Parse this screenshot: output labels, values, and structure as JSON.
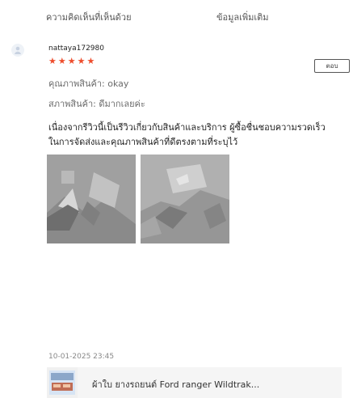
{
  "tabs": {
    "left": "ความคิดเห็นที่เห็นด้วย",
    "right": "ข้อมูลเพิ่มเติม"
  },
  "review": {
    "username": "nattaya172980",
    "rating": 5,
    "reply_label": "ตอบ",
    "quality_label": "คุณภาพสินค้า: okay",
    "condition_label": "สภาพสินค้า: ดีมากเลยค่ะ",
    "comment": "เนื่องจากรีวิวนี้เป็นรีวิวเกี่ยวกับสินค้าและบริการ ผู้ซื้อชื่นชอบความรวดเร็วในการจัดส่งและคุณภาพสินค้าที่ดีตรงตามที่ระบุไว้",
    "timestamp": "10-01-2025 23:45",
    "product_name": "ผ้าใบ ยางรถยนต์ Ford ranger Wildtrak..."
  },
  "colors": {
    "star": "#ee4d2d",
    "button_border": "#555555"
  },
  "icons": {
    "avatar": "user-avatar-icon",
    "star": "star-icon",
    "reply": "reply-icon",
    "photo": "image-icon",
    "product": "product-thumbnail-icon"
  }
}
